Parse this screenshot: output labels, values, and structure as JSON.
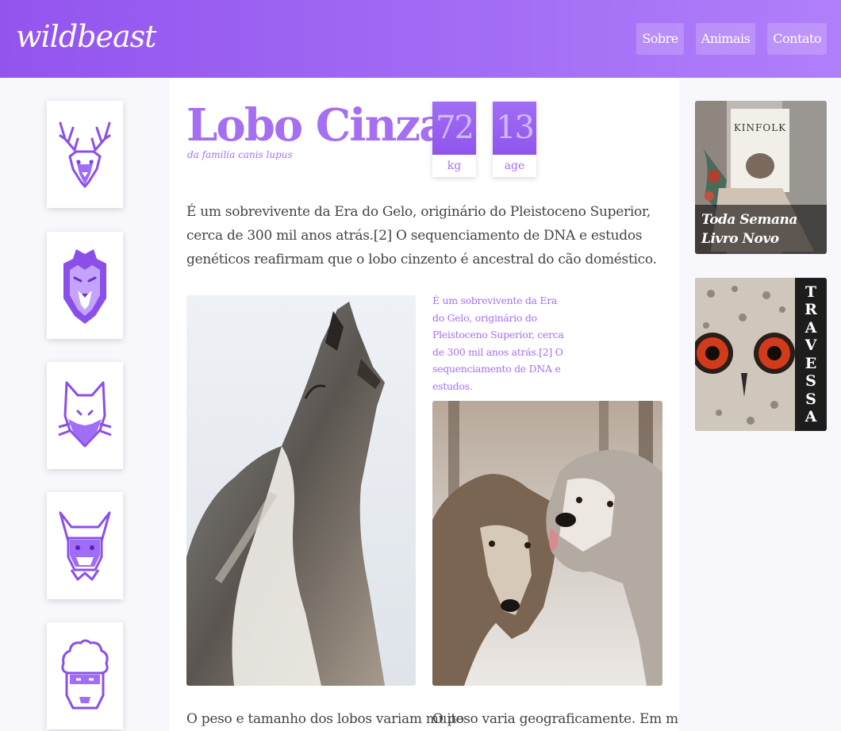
{
  "header": {
    "logo": "wildbeast",
    "nav": [
      "Sobre",
      "Animais",
      "Contato"
    ]
  },
  "sidebar": {
    "animals": [
      "deer-icon",
      "lion-icon",
      "fox-icon",
      "buffalo-icon",
      "sheep-icon"
    ]
  },
  "article": {
    "title": "Lobo Cinza",
    "subtitle": "da familia canis lupus",
    "stats": [
      {
        "value": "72",
        "unit": "kg"
      },
      {
        "value": "13",
        "unit": "age"
      }
    ],
    "intro": "É um sobrevivente da Era do Gelo, originário do Pleistoceno Superior, cerca de 300 mil anos atrás.[2] O sequenciamento de DNA e estudos genéticos reafirmam que o lobo cinzento é ancestral do cão doméstico.",
    "quote": "É um sobrevivente da Era do Gelo, originário do Pleistoceno Superior, cerca de 300 mil anos atrás.[2] O sequenciamento de DNA e estudos.",
    "bottom_left": "O peso e tamanho dos lobos variam muito",
    "bottom_right": "O peso varia geograficamente. Em média,"
  },
  "promos": {
    "book_caption_line1": "Toda Semana",
    "book_caption_line2": "Livro Novo",
    "book_cover_text": "KINFOLK",
    "owl_letters": [
      "T",
      "R",
      "A",
      "V",
      "E",
      "S",
      "S",
      "A"
    ]
  },
  "colors": {
    "accent": "#a66ff2",
    "header_start": "#9354ee",
    "header_end": "#b07ffa"
  }
}
